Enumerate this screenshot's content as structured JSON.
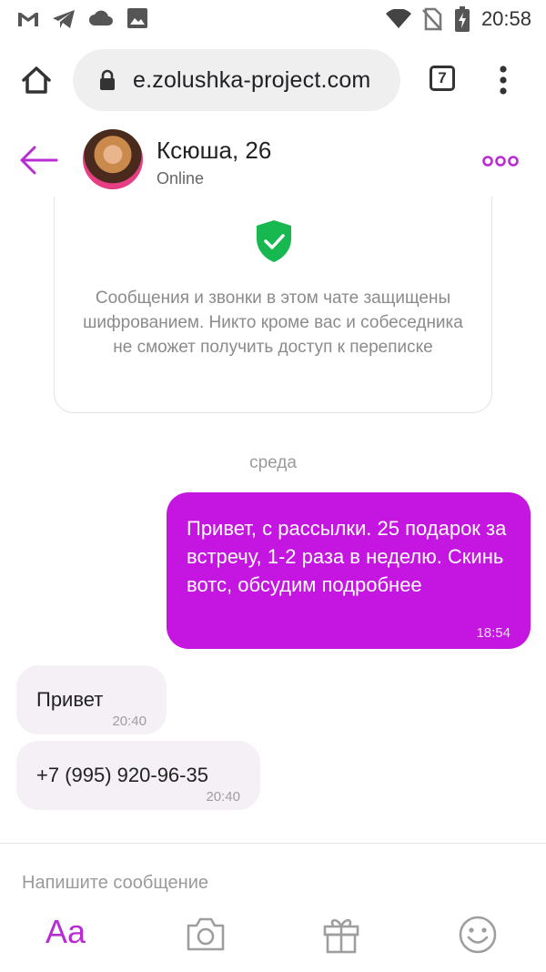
{
  "status_bar": {
    "time": "20:58",
    "icons": [
      "gmail-icon",
      "telegram-icon",
      "cloud-icon",
      "image-icon",
      "wifi-icon",
      "no-sim-icon",
      "battery-charging-icon"
    ]
  },
  "browser": {
    "url": "e.zolushka-project.com",
    "tab_count": "7"
  },
  "chat": {
    "contact_name": "Ксюша, 26",
    "contact_status": "Online",
    "encryption_notice": "Сообщения и звонки в этом чате защищены шифрованием. Никто кроме вас и собеседника не сможет получить доступ к переписке",
    "date_divider": "среда",
    "messages": [
      {
        "direction": "outgoing",
        "text": "Привет, с рассылки. 25 подарок за встречу, 1-2 раза в неделю. Скинь вотс, обсудим подробнее",
        "time": "18:54"
      },
      {
        "direction": "incoming",
        "text": "Привет",
        "time": "20:40"
      },
      {
        "direction": "incoming",
        "text": "+7 (995) 920-96-35",
        "time": "20:40"
      }
    ]
  },
  "composer": {
    "placeholder": "Напишите сообщение",
    "text_format_label": "Aa"
  },
  "colors": {
    "accent": "#c515e0",
    "incoming_bubble": "#f4f0f6",
    "shield": "#17b84f"
  }
}
